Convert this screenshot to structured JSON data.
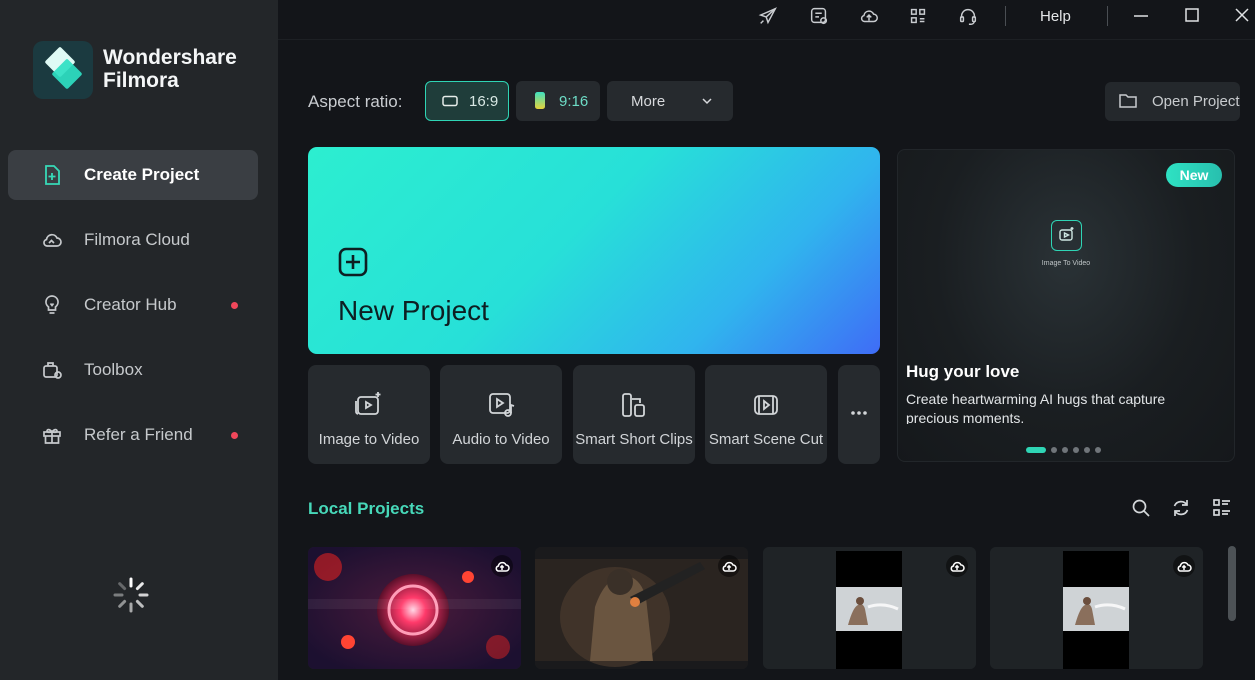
{
  "app": {
    "brand_line1": "Wondershare",
    "brand_line2": "Filmora"
  },
  "sidebar": {
    "items": [
      {
        "label": "Create Project",
        "icon": "add-file-icon",
        "active": true,
        "dot": false
      },
      {
        "label": "Filmora Cloud",
        "icon": "cloud-icon",
        "active": false,
        "dot": false
      },
      {
        "label": "Creator Hub",
        "icon": "lightbulb-icon",
        "active": false,
        "dot": true
      },
      {
        "label": "Toolbox",
        "icon": "toolbox-icon",
        "active": false,
        "dot": false
      },
      {
        "label": "Refer a Friend",
        "icon": "gift-icon",
        "active": false,
        "dot": true
      }
    ]
  },
  "topbar": {
    "help": "Help",
    "icons": [
      "send-icon",
      "feedback-icon",
      "cloud-upload-icon",
      "grid-icon",
      "headset-icon"
    ]
  },
  "aspect": {
    "label": "Aspect ratio:",
    "options": [
      "16:9",
      "9:16"
    ],
    "selected": "16:9",
    "more": "More",
    "open_project": "Open Project"
  },
  "new_project": {
    "label": "New Project"
  },
  "tiles": [
    {
      "label": "Image to Video",
      "icon": "image-to-video-icon"
    },
    {
      "label": "Audio to Video",
      "icon": "audio-to-video-icon"
    },
    {
      "label": "Smart Short Clips",
      "icon": "smart-short-clips-icon"
    },
    {
      "label": "Smart Scene Cut",
      "icon": "smart-scene-cut-icon"
    }
  ],
  "promo": {
    "badge": "New",
    "inner_label": "Image To Video",
    "title": "Hug your love",
    "description": "Create heartwarming AI hugs that capture precious moments.",
    "slides_total": 6,
    "active_slide": 1
  },
  "local_projects": {
    "title": "Local Projects",
    "items": [
      {
        "thumbnail": "red-sphere"
      },
      {
        "thumbnail": "soldier"
      },
      {
        "thumbnail": "portrait-video"
      },
      {
        "thumbnail": "portrait-video"
      }
    ]
  },
  "colors": {
    "accent": "#2fd5b5",
    "sidebar_bg": "#232629",
    "main_bg": "#131519",
    "notification_dot": "#f0475a"
  }
}
